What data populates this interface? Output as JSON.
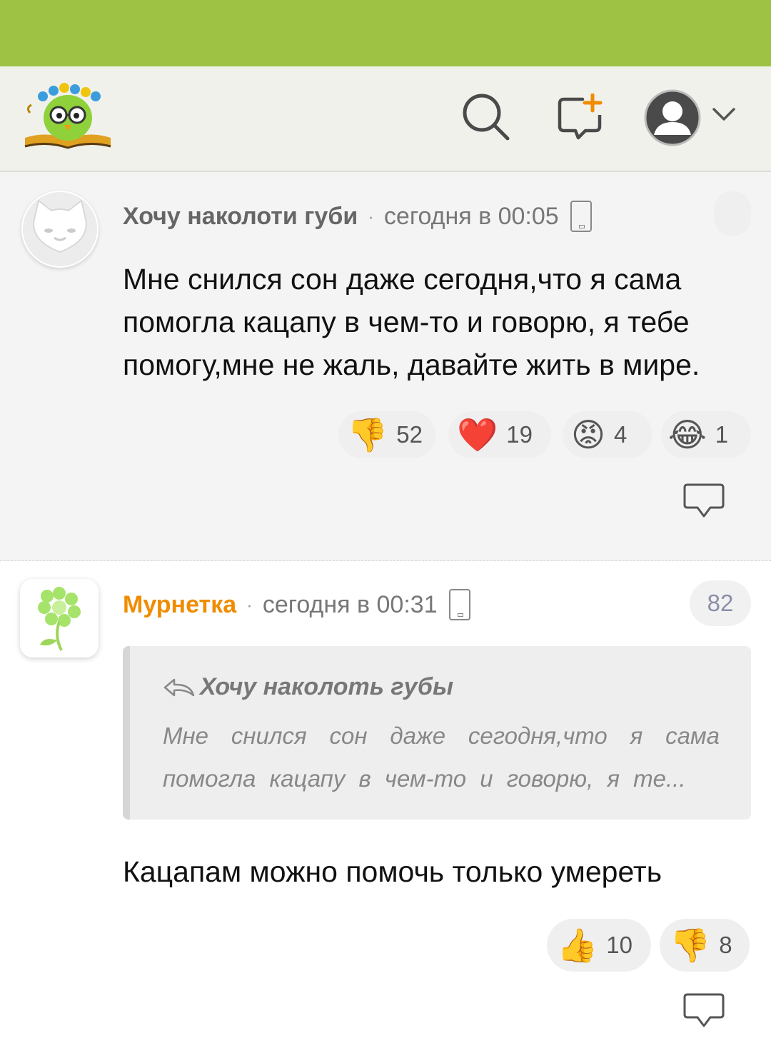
{
  "header": {
    "logo_icon": "owl-book-logo",
    "search_icon": "search-icon",
    "new_post_icon": "new-post-icon",
    "account_icon": "user-avatar-icon"
  },
  "comments": [
    {
      "author": "Хочу наколоти губи",
      "separator": "·",
      "time": "сегодня в 00:05",
      "text": "Мне снился сон даже сегодня,что я сама помогла кацапу в чем-то и говорю, я тебе помогу,мне не жаль, давайте жить в мире.",
      "reactions": [
        {
          "emoji": "👎",
          "count": "52"
        },
        {
          "emoji": "❤️",
          "count": "19"
        },
        {
          "emoji": "😡",
          "count": "4"
        },
        {
          "emoji": "😂",
          "count": "1"
        }
      ]
    },
    {
      "author": "Мурнетка",
      "separator": "·",
      "time": "сегодня в 00:31",
      "rating": "82",
      "quote": {
        "author": "Хочу наколоть губы",
        "text": "Мне снился сон даже сегодня,что я сама помогла кацапу в чем-то и говорю, я те..."
      },
      "text": "Кацапам можно помочь только умереть",
      "reactions": [
        {
          "emoji": "👍",
          "count": "10"
        },
        {
          "emoji": "👎",
          "count": "8"
        }
      ]
    }
  ],
  "colors": {
    "status_bar": "#9dc244",
    "header_bg": "#f1f1ec",
    "author_accent": "#f08c00"
  }
}
